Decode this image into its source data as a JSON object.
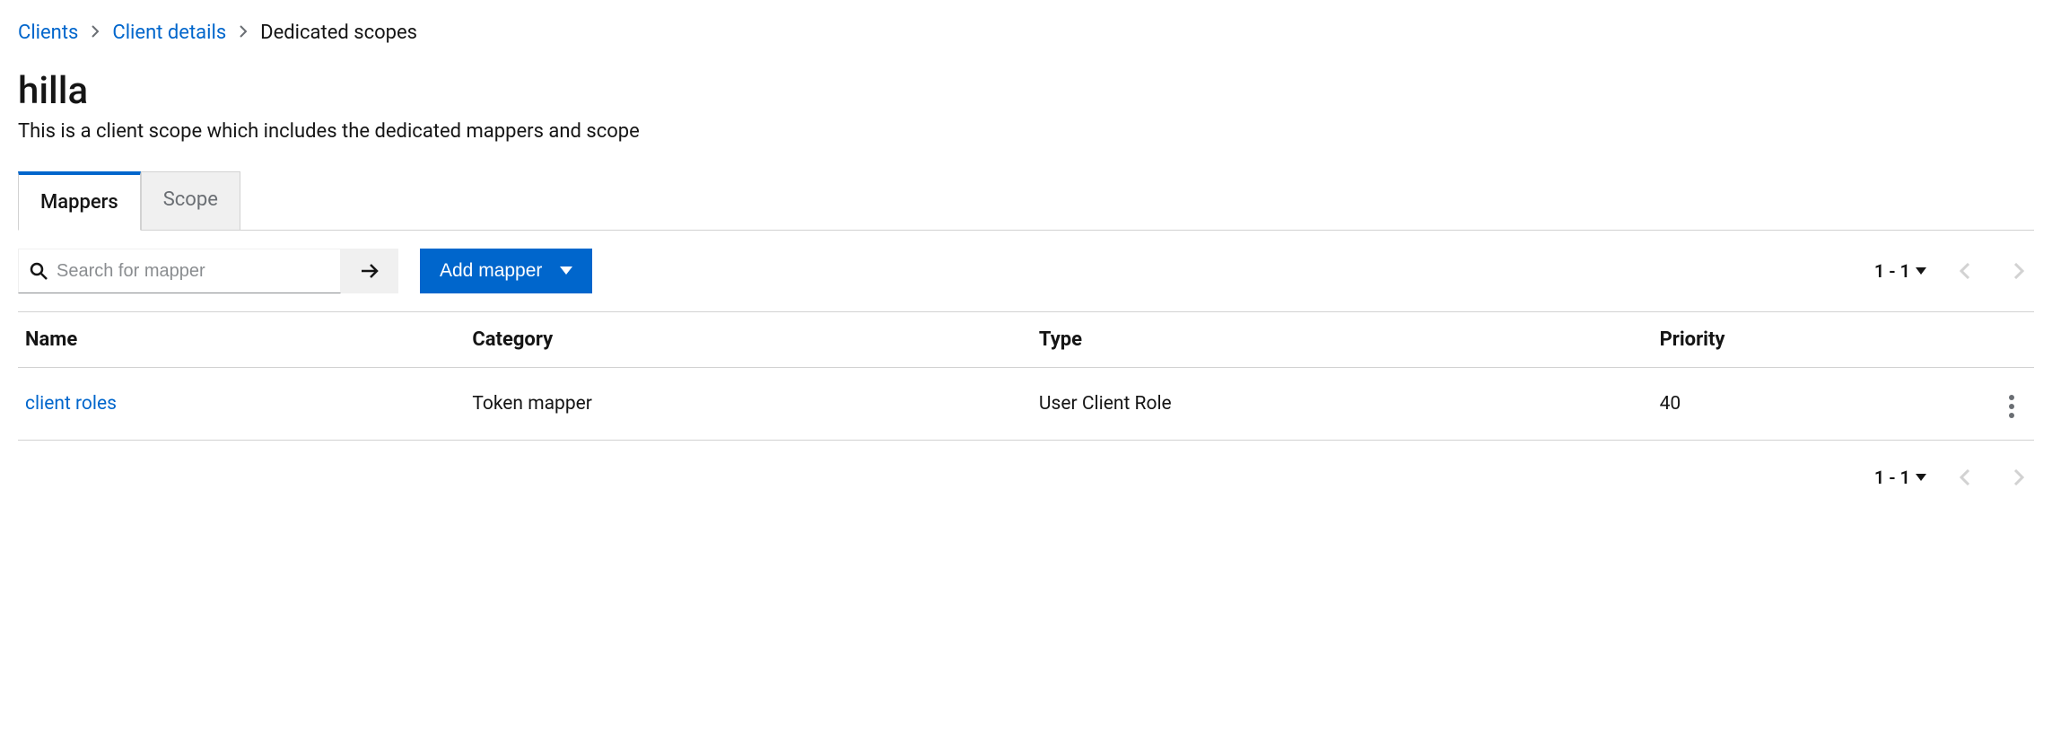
{
  "breadcrumb": {
    "items": [
      {
        "label": "Clients",
        "link": true
      },
      {
        "label": "Client details",
        "link": true
      },
      {
        "label": "Dedicated scopes",
        "link": false
      }
    ]
  },
  "page": {
    "title": "hilla",
    "description": "This is a client scope which includes the dedicated mappers and scope"
  },
  "tabs": [
    {
      "label": "Mappers",
      "active": true
    },
    {
      "label": "Scope",
      "active": false
    }
  ],
  "toolbar": {
    "search_placeholder": "Search for mapper",
    "add_label": "Add mapper"
  },
  "pagination": {
    "range": "1 - 1"
  },
  "table": {
    "headers": [
      "Name",
      "Category",
      "Type",
      "Priority"
    ],
    "rows": [
      {
        "name": "client roles",
        "category": "Token mapper",
        "type": "User Client Role",
        "priority": "40"
      }
    ]
  }
}
